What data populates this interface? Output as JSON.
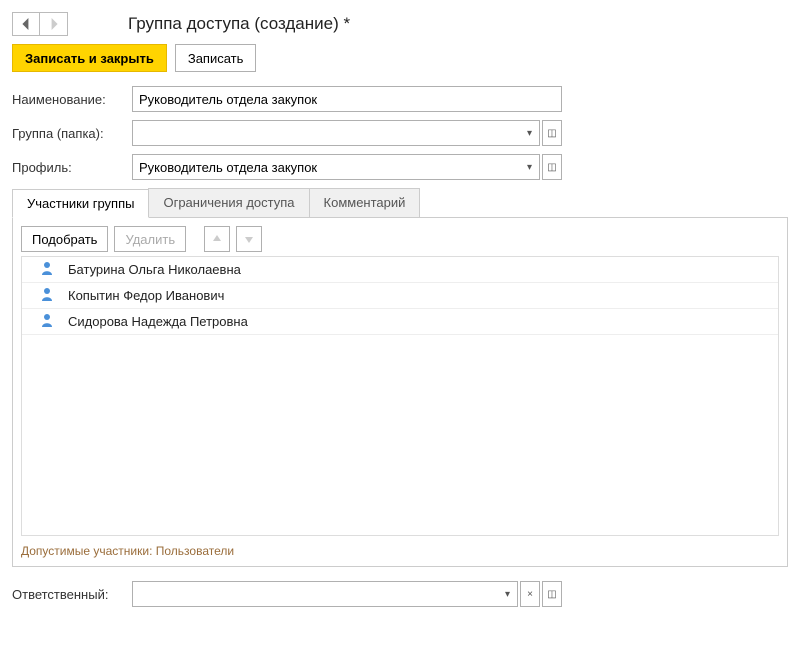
{
  "header": {
    "title": "Группа доступа (создание) *"
  },
  "toolbar": {
    "save_close": "Записать и закрыть",
    "save": "Записать"
  },
  "fields": {
    "name_label": "Наименование:",
    "name_value": "Руководитель отдела закупок",
    "group_label": "Группа (папка):",
    "group_value": "",
    "profile_label": "Профиль:",
    "profile_value": "Руководитель отдела закупок",
    "responsible_label": "Ответственный:",
    "responsible_value": ""
  },
  "tabs": {
    "members": "Участники группы",
    "restrictions": "Ограничения доступа",
    "comment": "Комментарий"
  },
  "sub_toolbar": {
    "pick": "Подобрать",
    "delete": "Удалить"
  },
  "members": [
    {
      "name": "Батурина Ольга Николаевна"
    },
    {
      "name": "Копытин Федор Иванович"
    },
    {
      "name": "Сидорова Надежда Петровна"
    }
  ],
  "hint": "Допустимые участники: Пользователи"
}
